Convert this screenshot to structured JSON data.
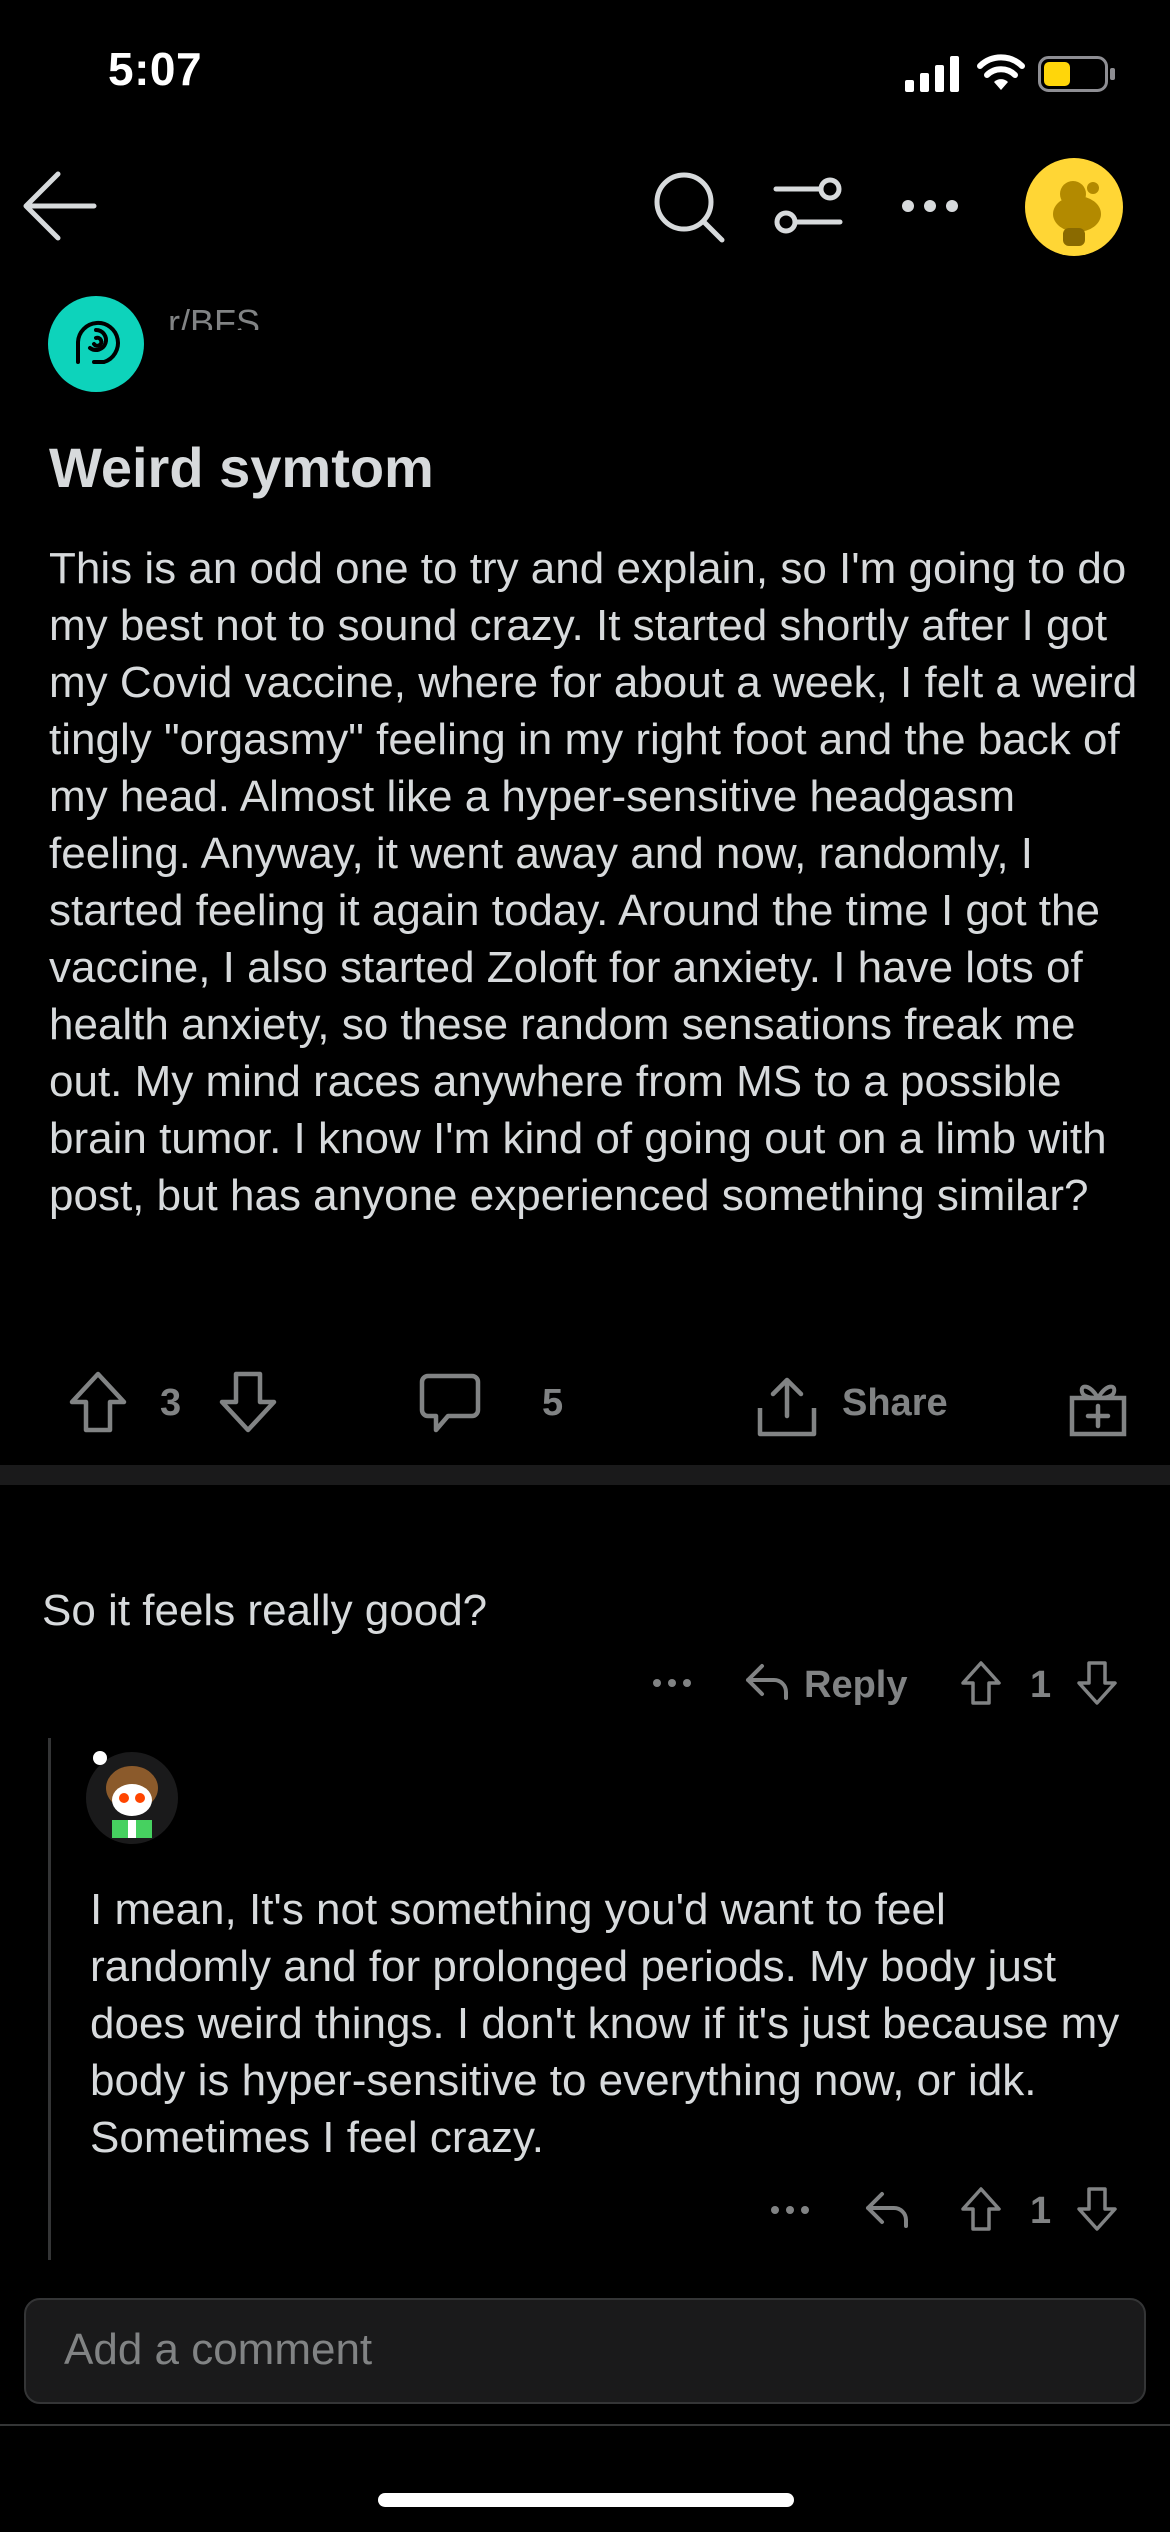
{
  "status_bar": {
    "time": "5:07"
  },
  "subreddit": {
    "name": "r/BFS"
  },
  "post": {
    "title": "Weird symtom",
    "body": "This is an odd one to try and explain, so I'm going to do my best not to sound crazy. It started shortly after I got my Covid vaccine, where for about a week, I felt a weird tingly \"orgasmy\" feeling in my right foot and the back of my head. Almost like a hyper-sensitive headgasm feeling. Anyway, it went away and now, randomly, I started feeling it again today. Around the time I got the vaccine, I also started Zoloft for anxiety. I have lots of health anxiety, so these random sensations freak me out. My mind races anywhere from MS to a possible brain tumor. I know I'm kind of going out on a limb with post, but has anyone experienced something similar?",
    "votes": "3",
    "comments": "5",
    "share_label": "Share"
  },
  "comments": [
    {
      "text": "So it feels really good?",
      "reply_label": "Reply",
      "votes": "1"
    },
    {
      "text": "I mean, It's not something you'd want to feel randomly and for prolonged periods. My body just does weird things. I don't know if it's just because my body is hyper-sensitive to everything now, or idk. Sometimes I feel crazy.",
      "votes": "1"
    }
  ],
  "comment_input": {
    "placeholder": "Add a comment"
  },
  "colors": {
    "background": "#000000",
    "text": "#d7dadc",
    "muted": "#818384",
    "subreddit_icon": "#0dd3bb",
    "avatar": "#ffd635",
    "battery": "#ffd60a"
  },
  "icons": [
    "back-arrow-icon",
    "search-icon",
    "sort-icon",
    "more-icon",
    "upvote-icon",
    "downvote-icon",
    "comment-icon",
    "share-icon",
    "award-icon",
    "reply-icon"
  ]
}
